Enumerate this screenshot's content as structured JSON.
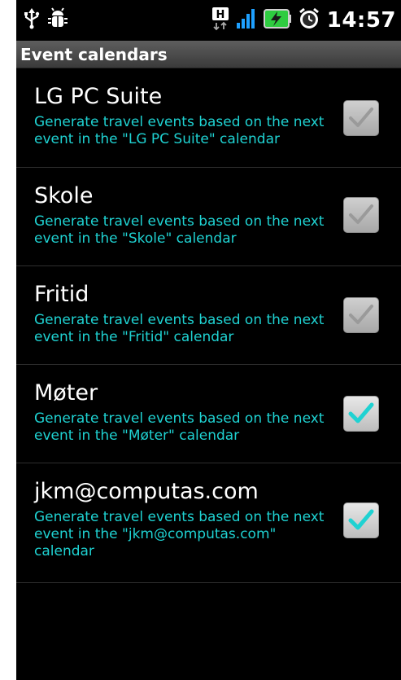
{
  "status_bar": {
    "time": "14:57",
    "icons": [
      "usb-icon",
      "debug-bug-icon",
      "hspa-icon",
      "signal-icon",
      "battery-charging-icon",
      "alarm-icon"
    ],
    "colors": {
      "battery": "#2ecc40",
      "signal": "#1ea0ff"
    }
  },
  "header": {
    "title": "Event calendars"
  },
  "calendars": [
    {
      "title": "LG PC Suite",
      "subtitle": "Generate travel events based on the next event in the \"LG PC Suite\" calendar",
      "checked": true,
      "enabled": false
    },
    {
      "title": "Skole",
      "subtitle": "Generate travel events based on the next event in the \"Skole\" calendar",
      "checked": true,
      "enabled": false
    },
    {
      "title": "Fritid",
      "subtitle": "Generate travel events based on the next event in the \"Fritid\" calendar",
      "checked": true,
      "enabled": false
    },
    {
      "title": "Møter",
      "subtitle": "Generate travel events based on the next event in the \"Møter\" calendar",
      "checked": true,
      "enabled": true
    },
    {
      "title": "jkm@computas.com",
      "subtitle": "Generate travel events based on the next event in the \"jkm@computas.com\" calendar",
      "checked": true,
      "enabled": true
    }
  ],
  "colors": {
    "accent": "#1fd2d2",
    "check_active": "#1fd2d2",
    "check_dim": "#b5b5b5"
  }
}
